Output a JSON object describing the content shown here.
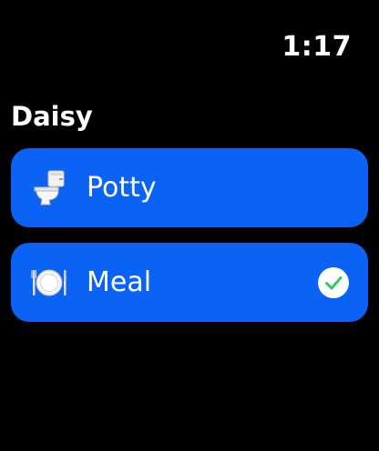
{
  "status_bar": {
    "time": "1:17"
  },
  "page": {
    "title": "Daisy"
  },
  "actions": [
    {
      "label": "Potty",
      "icon": "toilet-icon",
      "checked": false
    },
    {
      "label": "Meal",
      "icon": "plate-icon",
      "checked": true
    }
  ],
  "colors": {
    "background": "#000000",
    "row_fill": "#0a63f5",
    "check_fill": "#ffffff",
    "check_mark": "#34c759"
  }
}
